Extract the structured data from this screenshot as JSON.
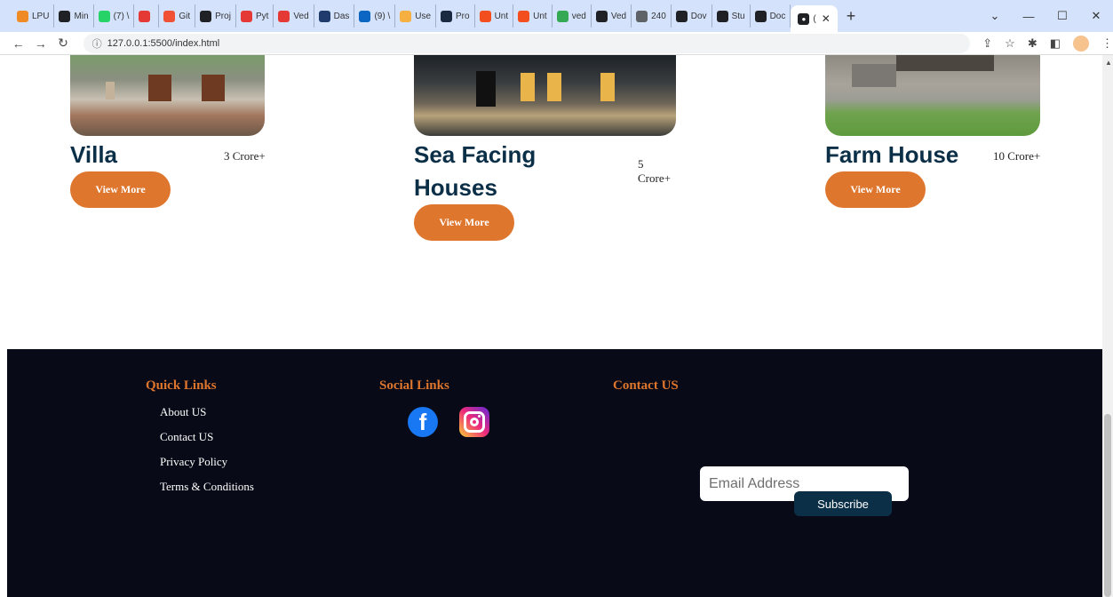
{
  "browser": {
    "tabs": [
      {
        "label": "LPU",
        "color": "#f08a24",
        "icon": "lpu-icon"
      },
      {
        "label": "Min",
        "color": "#202124",
        "icon": "chrome-icon"
      },
      {
        "label": "(7) \\",
        "color": "#25d366",
        "icon": "whatsapp-icon"
      },
      {
        "label": "",
        "color": "#e53935",
        "icon": "record-icon"
      },
      {
        "label": "Git",
        "color": "#f05033",
        "icon": "git-icon"
      },
      {
        "label": "Proj",
        "color": "#202124",
        "icon": "github-icon"
      },
      {
        "label": "Pyt",
        "color": "#e53935",
        "icon": "search-q-icon"
      },
      {
        "label": "Ved",
        "color": "#e53935",
        "icon": "search-q-icon"
      },
      {
        "label": "Das",
        "color": "#1f3b6e",
        "icon": "dashboard-icon"
      },
      {
        "label": "(9) \\",
        "color": "#0a66c2",
        "icon": "linkedin-icon"
      },
      {
        "label": "Use",
        "color": "#f5b041",
        "icon": "user-icon"
      },
      {
        "label": "Pro",
        "color": "#1a2a40",
        "icon": "profile-icon"
      },
      {
        "label": "Unt",
        "color": "#f24e1e",
        "icon": "figma-icon"
      },
      {
        "label": "Unt",
        "color": "#f24e1e",
        "icon": "figma-icon"
      },
      {
        "label": "ved",
        "color": "#34a853",
        "icon": "link-icon"
      },
      {
        "label": "Ved",
        "color": "#202124",
        "icon": "github-icon"
      },
      {
        "label": "240",
        "color": "#5f6368",
        "icon": "drive-icon"
      },
      {
        "label": "Dov",
        "color": "#202124",
        "icon": "download-icon"
      },
      {
        "label": "Stu",
        "color": "#202124",
        "icon": "chrome-icon"
      },
      {
        "label": "Doc",
        "color": "#202124",
        "icon": "chrome-icon"
      }
    ],
    "active_tab_label": "(",
    "url": "127.0.0.1:5500/index.html"
  },
  "properties": [
    {
      "title": "Villa",
      "price": "3 Crore+",
      "button": "View More"
    },
    {
      "title_line1": "Sea Facing",
      "title_line2": "Houses",
      "price_line1": "5",
      "price_line2": "Crore+",
      "button": "View More"
    },
    {
      "title": "Farm House",
      "price": "10 Crore+",
      "button": "View More"
    }
  ],
  "footer": {
    "quick_links": {
      "heading": "Quick Links",
      "items": [
        "About US",
        "Contact US",
        "Privacy Policy",
        "Terms & Conditions"
      ]
    },
    "social_links": {
      "heading": "Social Links",
      "icons": [
        "facebook-icon",
        "instagram-icon"
      ]
    },
    "contact": {
      "heading": "Contact US",
      "email_placeholder": "Email Address",
      "subscribe_label": "Subscribe"
    }
  },
  "colors": {
    "accent": "#df762d",
    "title": "#0c2f48",
    "footer_bg": "#080b17"
  }
}
